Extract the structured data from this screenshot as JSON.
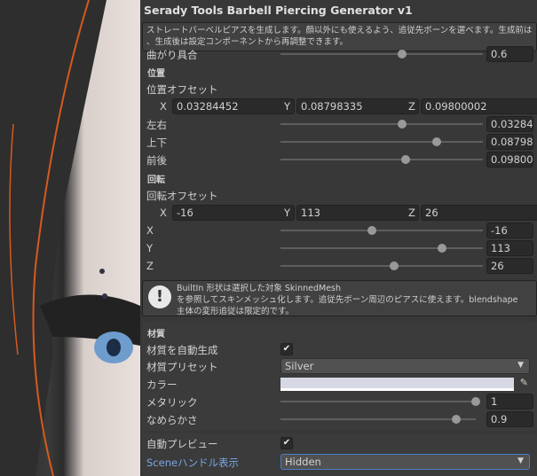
{
  "title": "Serady Tools Barbell Piercing Generator v1",
  "description": [
    "ストレートバーベルピアスを生成します。顔以外にも使えるよう、追従先ボーンを選べます。生成前はシーンプレビュー",
    "、生成後は設定コンポーネントから再調整できます。"
  ],
  "bend": {
    "label": "曲がり具合",
    "value": "0.6",
    "fraction": 0.6
  },
  "position": {
    "header": "位置",
    "offset_label": "位置オフセット",
    "x": "0.03284452",
    "y": "0.08798335",
    "z": "0.09800002",
    "sliders": [
      {
        "label": "左右",
        "value": "0.03284",
        "fraction": 0.6
      },
      {
        "label": "上下",
        "value": "0.08798",
        "fraction": 0.77
      },
      {
        "label": "前後",
        "value": "0.09800",
        "fraction": 0.62
      }
    ]
  },
  "rotation": {
    "header": "回転",
    "offset_label": "回転オフセット",
    "x": "-16",
    "y": "113",
    "z": "26",
    "sliders": [
      {
        "label": "X",
        "value": "-16",
        "fraction": 0.45
      },
      {
        "label": "Y",
        "value": "113",
        "fraction": 0.8
      },
      {
        "label": "Z",
        "value": "26",
        "fraction": 0.56
      }
    ]
  },
  "axes": {
    "x": "X",
    "y": "Y",
    "z": "Z"
  },
  "info": [
    "BuiltIn 形状は選択した対象 SkinnedMesh",
    "を参照してスキンメッシュ化します。追従先ボーン周辺のピアスに使えます。blendshape",
    "主体の変形追従は限定的です。"
  ],
  "material": {
    "header": "材質",
    "auto_label": "材質を自動生成",
    "auto_checked": true,
    "preset_label": "材質プリセット",
    "preset_value": "Silver",
    "color_label": "カラー",
    "color": "#d6d9e3",
    "metallic_label": "メタリック",
    "metallic_value": "1",
    "metallic_fraction": 1.0,
    "smooth_label": "なめらかさ",
    "smooth_value": "0.9",
    "smooth_fraction": 0.9
  },
  "auto_preview": {
    "label": "自動プレビュー",
    "checked": true
  },
  "scene_handle": {
    "label": "Sceneハンドル表示",
    "value": "Hidden"
  },
  "check_glyph": "✔",
  "arrow_glyph": "▼"
}
